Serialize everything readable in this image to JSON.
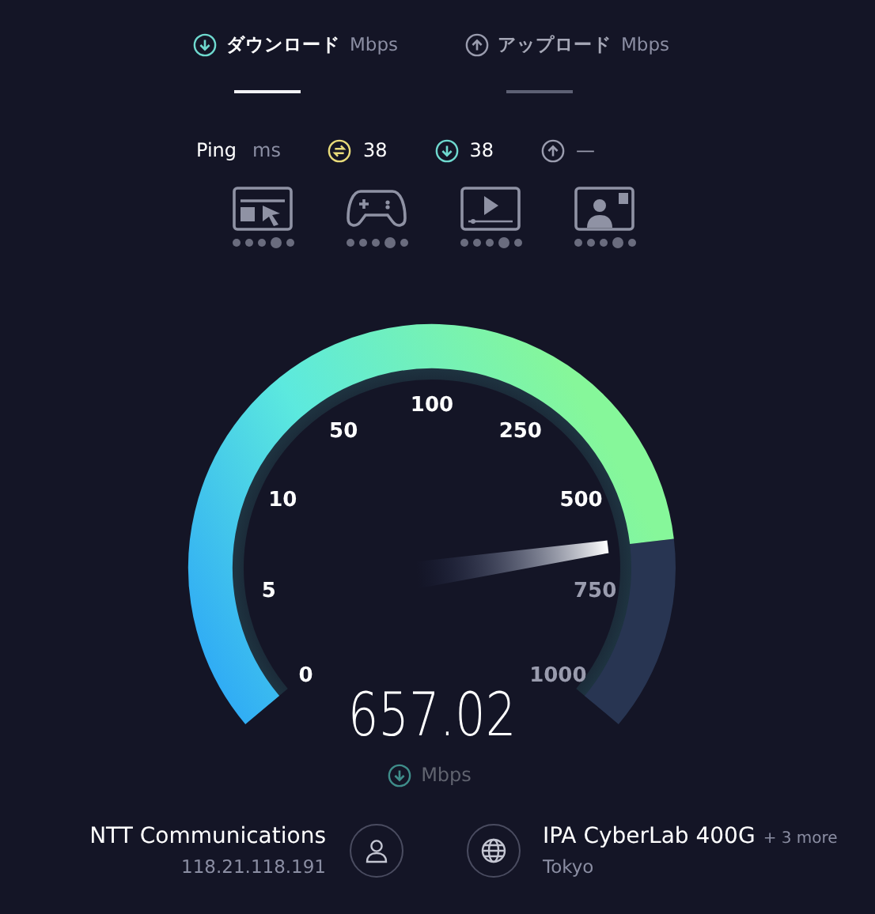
{
  "tabs": [
    {
      "label": "ダウンロード",
      "unit": "Mbps",
      "selected": true
    },
    {
      "label": "アップロード",
      "unit": "Mbps",
      "selected": false
    }
  ],
  "ping": {
    "label": "Ping",
    "unit": "ms",
    "values": [
      {
        "kind": "idle",
        "value": "38"
      },
      {
        "kind": "download",
        "value": "38"
      },
      {
        "kind": "upload",
        "value": "—"
      }
    ]
  },
  "activities": [
    {
      "kind": "browsing"
    },
    {
      "kind": "gaming"
    },
    {
      "kind": "streaming"
    },
    {
      "kind": "video_call"
    }
  ],
  "gauge": {
    "ticks": [
      "0",
      "5",
      "10",
      "50",
      "100",
      "250",
      "500",
      "750",
      "1000"
    ],
    "reading": "657.02",
    "unit": "Mbps"
  },
  "provider": {
    "name": "NTT Communications",
    "ip": "118.21.118.191"
  },
  "server": {
    "name": "IPA CyberLab 400G",
    "more": "+ 3 more",
    "location": "Tokyo"
  }
}
